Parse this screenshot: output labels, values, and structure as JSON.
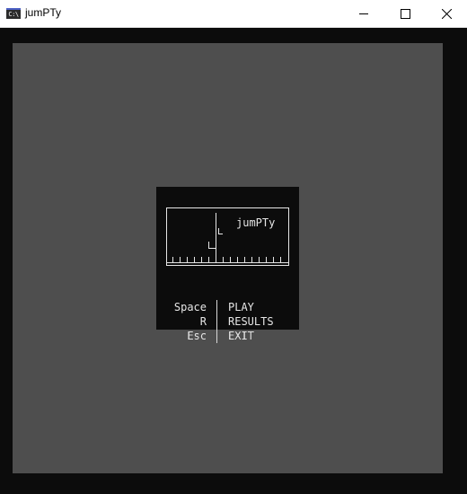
{
  "window": {
    "title": "jumPTy",
    "icon": "console-app-icon",
    "icon_glyph": "C:\\",
    "controls": [
      "minimize",
      "maximize",
      "close"
    ]
  },
  "colors": {
    "background": "#0c0c0c",
    "foreground": "#e6e6e6",
    "field_dots": "#8a8a8a",
    "icon_accent": "#4b5fc4"
  },
  "logo": {
    "title": "jumPTy"
  },
  "menu": {
    "items": [
      {
        "key": "Space",
        "action": "PLAY"
      },
      {
        "key": "R",
        "action": "RESULTS"
      },
      {
        "key": "Esc",
        "action": "EXIT"
      }
    ]
  }
}
